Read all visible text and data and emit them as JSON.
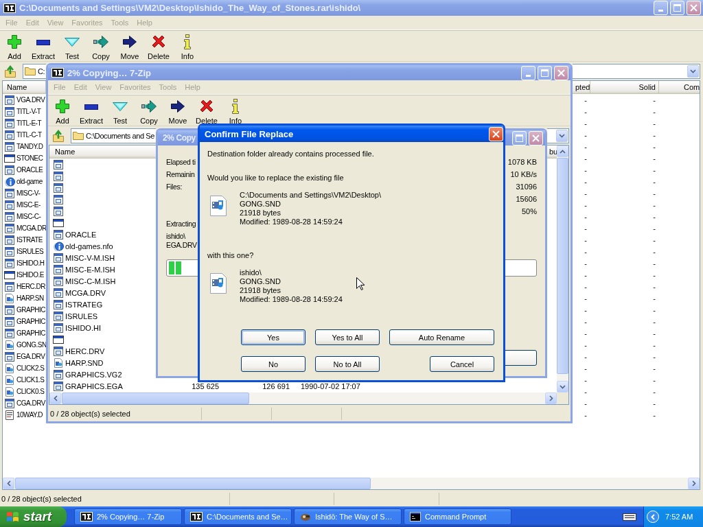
{
  "main_window": {
    "title": "C:\\Documents and Settings\\VM2\\Desktop\\Ishido_The_Way_of_Stones.rar\\ishido\\",
    "menu": [
      "File",
      "Edit",
      "View",
      "Favorites",
      "Tools",
      "Help"
    ],
    "toolbar": [
      {
        "kind": "add",
        "label": "Add"
      },
      {
        "kind": "extract",
        "label": "Extract"
      },
      {
        "kind": "test",
        "label": "Test"
      },
      {
        "kind": "copy",
        "label": "Copy"
      },
      {
        "kind": "move",
        "label": "Move"
      },
      {
        "kind": "delete",
        "label": "Delete"
      },
      {
        "kind": "info",
        "label": "Info"
      }
    ],
    "address": "C:",
    "columns": [
      "Name",
      "pted",
      "Solid",
      "Com"
    ],
    "rows": [
      {
        "kind": "doc",
        "cells": [
          "VGA.DRV",
          "-",
          "-"
        ]
      },
      {
        "kind": "doc",
        "cells": [
          "TITL-V-T",
          "-",
          "-"
        ]
      },
      {
        "kind": "doc",
        "cells": [
          "TITL-E-T",
          "-",
          "-"
        ]
      },
      {
        "kind": "doc",
        "cells": [
          "TITL-C-T",
          "-",
          "-"
        ]
      },
      {
        "kind": "doc",
        "cells": [
          "TANDY.D",
          "-",
          "-"
        ]
      },
      {
        "kind": "app",
        "cells": [
          "STONEC",
          "-",
          "-"
        ]
      },
      {
        "kind": "doc",
        "cells": [
          "ORACLE",
          "-",
          "-"
        ]
      },
      {
        "kind": "info",
        "cells": [
          "old-game",
          "-",
          "-"
        ]
      },
      {
        "kind": "doc",
        "cells": [
          "MISC-V-",
          "-",
          "-"
        ]
      },
      {
        "kind": "doc",
        "cells": [
          "MISC-E-",
          "-",
          "-"
        ]
      },
      {
        "kind": "doc",
        "cells": [
          "MISC-C-",
          "-",
          "-"
        ]
      },
      {
        "kind": "doc",
        "cells": [
          "MCGA.DR",
          "-",
          "-"
        ]
      },
      {
        "kind": "doc",
        "cells": [
          "ISTRATE",
          "-",
          "-"
        ]
      },
      {
        "kind": "doc",
        "cells": [
          "ISRULES",
          "-",
          "-"
        ]
      },
      {
        "kind": "doc",
        "cells": [
          "ISHIDO.H",
          "-",
          "-"
        ]
      },
      {
        "kind": "app",
        "cells": [
          "ISHIDO.E",
          "-",
          "-"
        ]
      },
      {
        "kind": "doc",
        "cells": [
          "HERC.DR",
          "-",
          "-"
        ]
      },
      {
        "kind": "sound",
        "cells": [
          "HARP.SN",
          "-",
          "-"
        ]
      },
      {
        "kind": "doc",
        "cells": [
          "GRAPHIC",
          "-",
          "-"
        ]
      },
      {
        "kind": "doc",
        "cells": [
          "GRAPHIC",
          "-",
          "-"
        ]
      },
      {
        "kind": "doc",
        "cells": [
          "GRAPHIC",
          "-",
          "-"
        ]
      },
      {
        "kind": "sound",
        "cells": [
          "GONG.SN",
          "-",
          "-"
        ]
      },
      {
        "kind": "doc",
        "cells": [
          "EGA.DRV",
          "-",
          "-"
        ]
      },
      {
        "kind": "sound",
        "cells": [
          "CLICK2.S",
          "-",
          "-"
        ]
      },
      {
        "kind": "sound",
        "cells": [
          "CLICK1.S",
          "-",
          "-"
        ]
      },
      {
        "kind": "sound",
        "cells": [
          "CLICK0.S",
          "-",
          "-"
        ]
      },
      {
        "kind": "doc",
        "cells": [
          "CGA.DRV",
          "-",
          "-"
        ]
      },
      {
        "kind": "text",
        "cells": [
          "10WAY.D",
          "-",
          "-"
        ]
      }
    ],
    "status": "0 / 28 object(s) selected"
  },
  "copy_window": {
    "title": "2% Copying… 7-Zip",
    "menu": [
      "File",
      "Edit",
      "View",
      "Favorites",
      "Tools",
      "Help"
    ],
    "toolbar": [
      {
        "kind": "add",
        "label": "Add"
      },
      {
        "kind": "extract",
        "label": "Extract"
      },
      {
        "kind": "test",
        "label": "Test"
      },
      {
        "kind": "copy",
        "label": "Copy"
      },
      {
        "kind": "move",
        "label": "Move"
      },
      {
        "kind": "delete",
        "label": "Delete"
      },
      {
        "kind": "info",
        "label": "Info"
      }
    ],
    "address": "C:\\Documents and Se",
    "columns": [
      "Name",
      "bu"
    ],
    "rows": [
      {
        "kind": "doc"
      },
      {
        "kind": "doc"
      },
      {
        "kind": "doc"
      },
      {
        "kind": "doc"
      },
      {
        "kind": "doc"
      },
      {
        "kind": "app"
      },
      {
        "kind": "doc",
        "name": "ORACLE"
      },
      {
        "kind": "info",
        "name": "old-games.nfo"
      },
      {
        "kind": "doc",
        "name": "MISC-V-M.ISH"
      },
      {
        "kind": "doc",
        "name": "MISC-E-M.ISH"
      },
      {
        "kind": "doc",
        "name": "MISC-C-M.ISH"
      },
      {
        "kind": "doc",
        "name": "MCGA.DRV"
      },
      {
        "kind": "doc",
        "name": "ISTRATEG"
      },
      {
        "kind": "doc",
        "name": "ISRULES"
      },
      {
        "kind": "doc",
        "name": "ISHIDO.HI"
      },
      {
        "kind": "app"
      },
      {
        "kind": "doc",
        "name": "HERC.DRV"
      },
      {
        "kind": "sound",
        "name": "HARP.SND"
      },
      {
        "kind": "doc",
        "name": "GRAPHICS.VG2"
      },
      {
        "kind": "doc",
        "name": "GRAPHICS.EGA",
        "cells": [
          "135 625",
          "126 691",
          "1990-07-02 17:07"
        ]
      }
    ],
    "status": "0 / 28 object(s) selected"
  },
  "progress_window": {
    "title": "2% Copy",
    "labels": [
      "Elapsed ti",
      "Remainin",
      "Files:"
    ],
    "values": [
      "1078 KB",
      "10 KB/s",
      "31096",
      "15606",
      "50%"
    ],
    "action": "Extracting",
    "path_lines": [
      "ishido\\",
      "EGA.DRV"
    ],
    "level": 0.035
  },
  "dialog": {
    "title": "Confirm File Replace",
    "message": "Destination folder already contains processed file.",
    "question": "Would you like to replace the existing file",
    "existing": [
      "C:\\Documents and Settings\\VM2\\Desktop\\",
      "GONG.SND",
      "21918 bytes",
      "Modified: 1989-08-28 14:59:24"
    ],
    "prompt": "with this one?",
    "replacement": [
      "ishido\\",
      "GONG.SND",
      "21918 bytes",
      "Modified: 1989-08-28 14:59:24"
    ],
    "buttons": [
      {
        "label": "Yes",
        "default": true
      },
      {
        "label": "Yes to All",
        "default": false
      },
      {
        "label": "Auto Rename",
        "default": false
      },
      {
        "label": "No",
        "default": false
      },
      {
        "label": "No to All",
        "default": false
      },
      {
        "label": "Cancel",
        "default": false
      }
    ]
  },
  "taskbar": {
    "start": "start",
    "tasks": [
      {
        "kind": "archiver",
        "label": "2% Copying… 7-Zip",
        "selected": false
      },
      {
        "kind": "archiver",
        "label": "C:\\Documents and Se…",
        "selected": false
      },
      {
        "kind": "game",
        "label": "Ishidō: The Way of S…",
        "selected": false
      },
      {
        "kind": "console",
        "label": "Command Prompt",
        "selected": false
      }
    ],
    "clock": "7:52 AM"
  }
}
